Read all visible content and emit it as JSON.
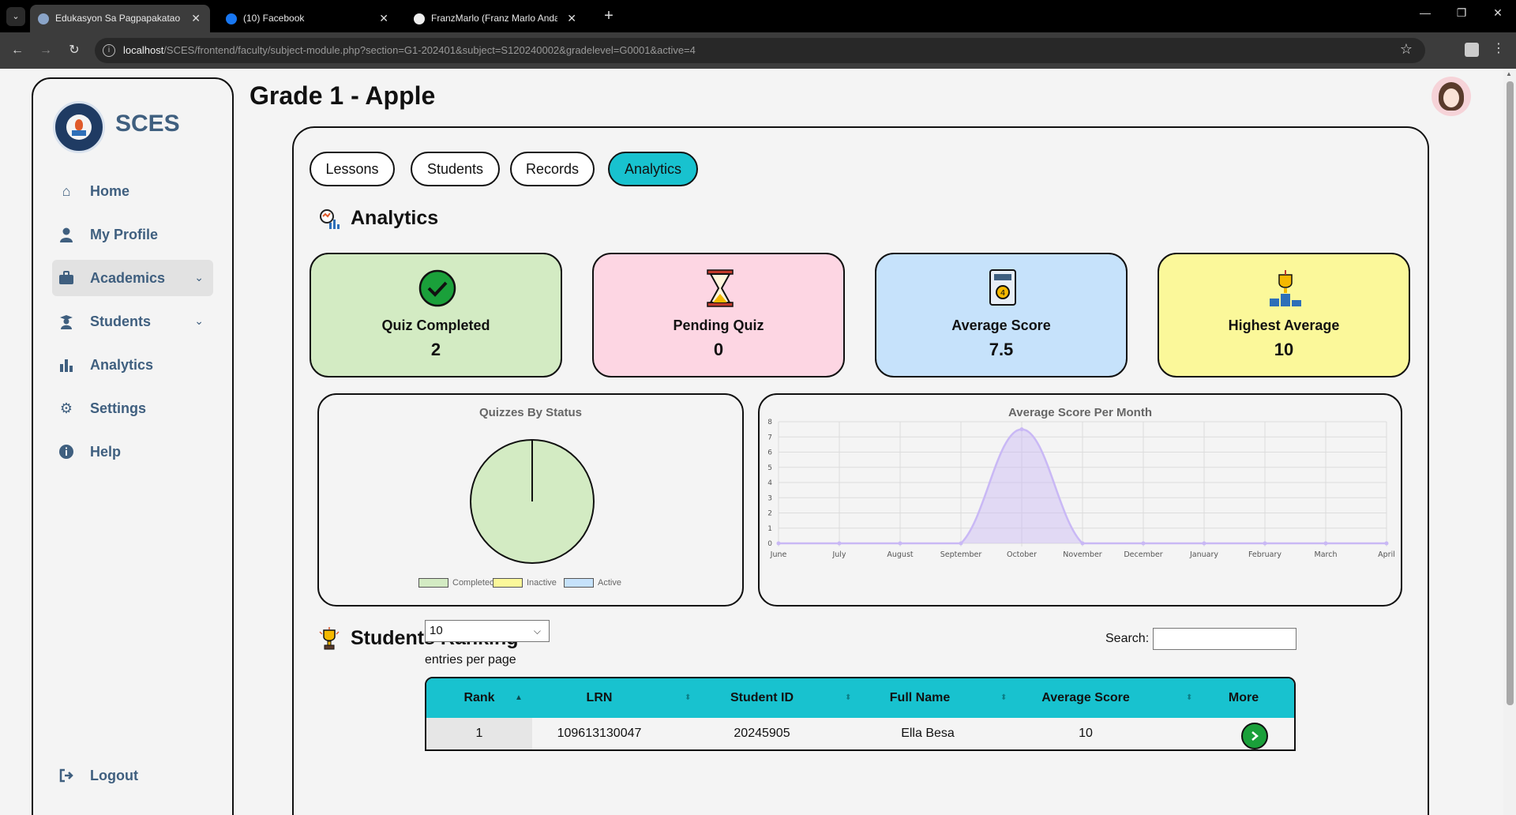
{
  "browser": {
    "tabs": [
      {
        "title": "Edukasyon Sa Pagpapakatao | S",
        "active": true
      },
      {
        "title": "(10) Facebook",
        "active": false
      },
      {
        "title": "FranzMarlo (Franz Marlo Andal)",
        "active": false
      }
    ],
    "url_host": "localhost",
    "url_path": "/SCES/frontend/faculty/subject-module.php?section=G1-202401&subject=S120240002&gradelevel=G0001&active=4"
  },
  "sidebar": {
    "brand": "SCES",
    "items": [
      {
        "label": "Home",
        "icon": "home-icon",
        "has_chevron": false,
        "highlighted": false
      },
      {
        "label": "My Profile",
        "icon": "user-icon",
        "has_chevron": false,
        "highlighted": false
      },
      {
        "label": "Academics",
        "icon": "briefcase-icon",
        "has_chevron": true,
        "highlighted": true
      },
      {
        "label": "Students",
        "icon": "student-icon",
        "has_chevron": true,
        "highlighted": false
      },
      {
        "label": "Analytics",
        "icon": "bar-chart-icon",
        "has_chevron": false,
        "highlighted": false
      },
      {
        "label": "Settings",
        "icon": "gear-icon",
        "has_chevron": false,
        "highlighted": false
      },
      {
        "label": "Help",
        "icon": "info-icon",
        "has_chevron": false,
        "highlighted": false
      }
    ],
    "logout": "Logout"
  },
  "header": {
    "title": "Grade 1 - Apple"
  },
  "tabs": [
    {
      "label": "Lessons",
      "active": false
    },
    {
      "label": "Students",
      "active": false
    },
    {
      "label": "Records",
      "active": false
    },
    {
      "label": "Analytics",
      "active": true
    }
  ],
  "analytics": {
    "title": "Analytics",
    "stats": [
      {
        "label": "Quiz Completed",
        "value": "2",
        "color": "#d3ebc3",
        "icon": "check-circle-icon"
      },
      {
        "label": "Pending Quiz",
        "value": "0",
        "color": "#fdd6e3",
        "icon": "hourglass-icon"
      },
      {
        "label": "Average Score",
        "value": "7.5",
        "color": "#c6e2fb",
        "icon": "certificate-icon"
      },
      {
        "label": "Highest Average",
        "value": "10",
        "color": "#fbf89a",
        "icon": "trophy-icon"
      }
    ]
  },
  "chart_data": [
    {
      "type": "pie",
      "title": "Quizzes By Status",
      "categories": [
        "Completed",
        "Inactive",
        "Active"
      ],
      "values": [
        2,
        0,
        0
      ],
      "colors": [
        "#d3ebc3",
        "#fbf89a",
        "#c6e2fb"
      ],
      "legend": "bottom"
    },
    {
      "type": "area",
      "title": "Average Score Per Month",
      "categories": [
        "June",
        "July",
        "August",
        "September",
        "October",
        "November",
        "December",
        "January",
        "February",
        "March",
        "April"
      ],
      "series": [
        {
          "values": [
            0,
            0,
            0,
            0,
            7.5,
            0,
            0,
            0,
            0,
            0,
            0
          ]
        }
      ],
      "ylim": [
        0,
        8
      ],
      "yticks": [
        0,
        1,
        2,
        3,
        4,
        5,
        6,
        7,
        8
      ],
      "grid": true,
      "color": "#c9b8f5"
    }
  ],
  "ranking": {
    "title": "Students Ranking",
    "entries_value": "10",
    "entries_label": "entries per page",
    "search_label": "Search:",
    "columns": [
      "Rank",
      "LRN",
      "Student ID",
      "Full Name",
      "Average Score",
      "More"
    ],
    "rows": [
      {
        "rank": "1",
        "lrn": "109613130047",
        "student_id": "20245905",
        "full_name": "Ella Besa",
        "average_score": "10"
      }
    ]
  }
}
